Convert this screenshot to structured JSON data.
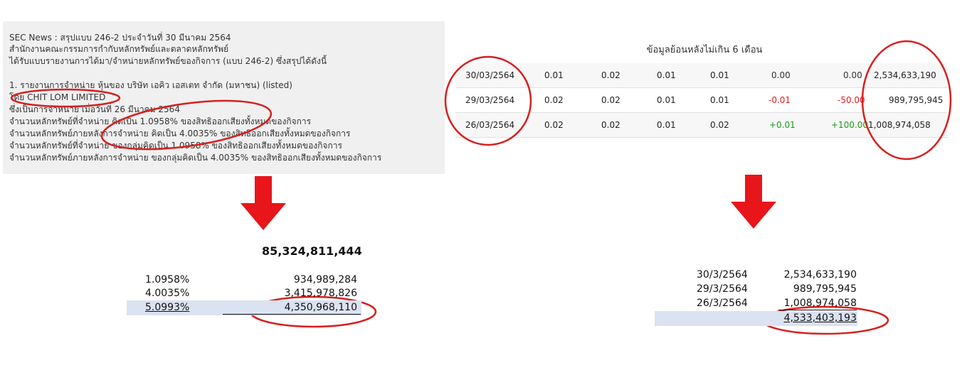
{
  "news": {
    "line1": "SEC News : สรุปแบบ 246-2 ประจำวันที่ 30 มีนาคม 2564",
    "line2": "สำนักงานคณะกรรมการกำกับหลักทรัพย์และตลาดหลักทรัพย์",
    "line3": "ได้รับแบบรายงานการได้มา/จำหน่ายหลักทรัพย์ของกิจการ (แบบ 246-2) ซึ่งสรุปได้ดังนี้",
    "line4": "1. รายงานการจำหน่าย หุ้นของ บริษัท เอคิว เอสเตท จำกัด (มหาชน) (listed)",
    "line5": "โดย CHIT LOM LIMITED",
    "line6": "ซึ่งเป็นการจำหน่าย เมื่อวันที่ 26 มีนาคม 2564",
    "line7": "จำนวนหลักทรัพย์ที่จำหน่าย คิดเป็น 1.0958% ของสิทธิออกเสียงทั้งหมดของกิจการ",
    "line8": "จำนวนหลักทรัพย์ภายหลังการจำหน่าย คิดเป็น 4.0035% ของสิทธิออกเสียงทั้งหมดของกิจการ",
    "line9": "จำนวนหลักทรัพย์ที่จำหน่าย ของกลุ่มคิดเป็น 1.0958% ของสิทธิออกเสียงทั้งหมดของกิจการ",
    "line10": "จำนวนหลักทรัพย์ภายหลังการจำหน่าย ของกลุ่มคิดเป็น 4.0035% ของสิทธิออกเสียงทั้งหมดของกิจการ"
  },
  "history": {
    "title": "ข้อมูลย้อนหลังไม่เกิน 6 เดือน",
    "rows": [
      {
        "date": "30/03/2564",
        "c1": "0.01",
        "c2": "0.02",
        "c3": "0.01",
        "c4": "0.01",
        "chg": "0.00",
        "pct": "0.00",
        "vol": "2,534,633,190"
      },
      {
        "date": "29/03/2564",
        "c1": "0.02",
        "c2": "0.02",
        "c3": "0.01",
        "c4": "0.01",
        "chg": "-0.01",
        "pct": "-50.00",
        "vol": "989,795,945"
      },
      {
        "date": "26/03/2564",
        "c1": "0.02",
        "c2": "0.02",
        "c3": "0.01",
        "c4": "0.02",
        "chg": "+0.01",
        "pct": "+100.00",
        "vol": "1,008,974,058"
      }
    ]
  },
  "calc_left": {
    "total_shares": "85,324,811,444",
    "rows": [
      {
        "pct": "1.0958%",
        "amount": "934,989,284"
      },
      {
        "pct": "4.0035%",
        "amount": "3,415,978,826"
      }
    ],
    "sum_pct": "5.0993%",
    "sum_amount": "4,350,968,110"
  },
  "calc_right": {
    "rows": [
      {
        "date": "30/3/2564",
        "volume": "2,534,633,190"
      },
      {
        "date": "29/3/2564",
        "volume": "989,795,945"
      },
      {
        "date": "26/3/2564",
        "volume": "1,008,974,058"
      }
    ],
    "sum_volume": "4,533,403,193"
  },
  "colors": {
    "arrow": "#e8151b",
    "circle": "#d81e1e",
    "band": "#dbe2f1",
    "positive": "#1a9c1a",
    "negative": "#e01a1a"
  }
}
